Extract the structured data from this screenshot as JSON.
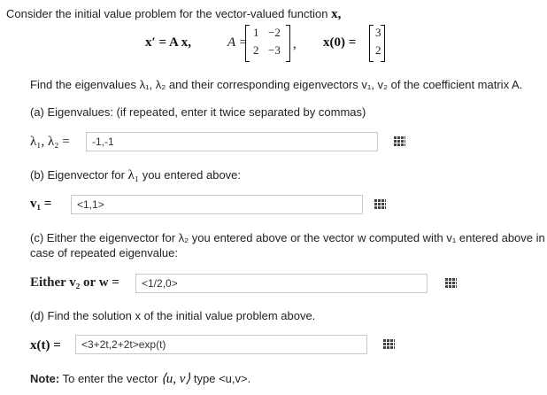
{
  "intro": "Consider the initial value problem for the vector-valued function",
  "intro_var": "x,",
  "equation": {
    "lhs": "x′ = A x,",
    "A_label": "A =",
    "matrix": [
      [
        "1",
        "−2"
      ],
      [
        "2",
        "−3"
      ]
    ],
    "comma": ",",
    "x0_label": "x(0) =",
    "x0": [
      "3",
      "2"
    ]
  },
  "instruction": "Find the eigenvalues λ₁, λ₂ and their corresponding eigenvectors v₁, v₂ of the coefficient matrix A.",
  "part_a": {
    "prompt": "(a) Eigenvalues: (if repeated, enter it twice separated by commas)",
    "label_lambda": "λ₁, λ₂ =",
    "value": "-1,-1"
  },
  "part_b": {
    "prompt_pre": "(b) Eigenvector for",
    "prompt_sym": "λ₁",
    "prompt_post": "you entered above:",
    "label": "v₁ =",
    "value": "<1,1>"
  },
  "part_c": {
    "prompt_line1": "(c) Either the eigenvector for λ₂ you entered above or the vector w computed with v₁ entered above in",
    "prompt_line2": "case of repeated eigenvalue:",
    "label": "Either v₂ or w =",
    "value": "<1/2,0>"
  },
  "part_d": {
    "prompt": "(d) Find the solution x of the initial value problem above.",
    "label": "x(t) =",
    "value": "<3+2t,2+2t>exp(t)"
  },
  "note": {
    "label": "Note:",
    "text_pre": "To enter the vector",
    "vec": "⟨u, v⟩",
    "text_post": "type <u,v>."
  },
  "icons": {
    "matrix_entry": "grid-icon"
  }
}
